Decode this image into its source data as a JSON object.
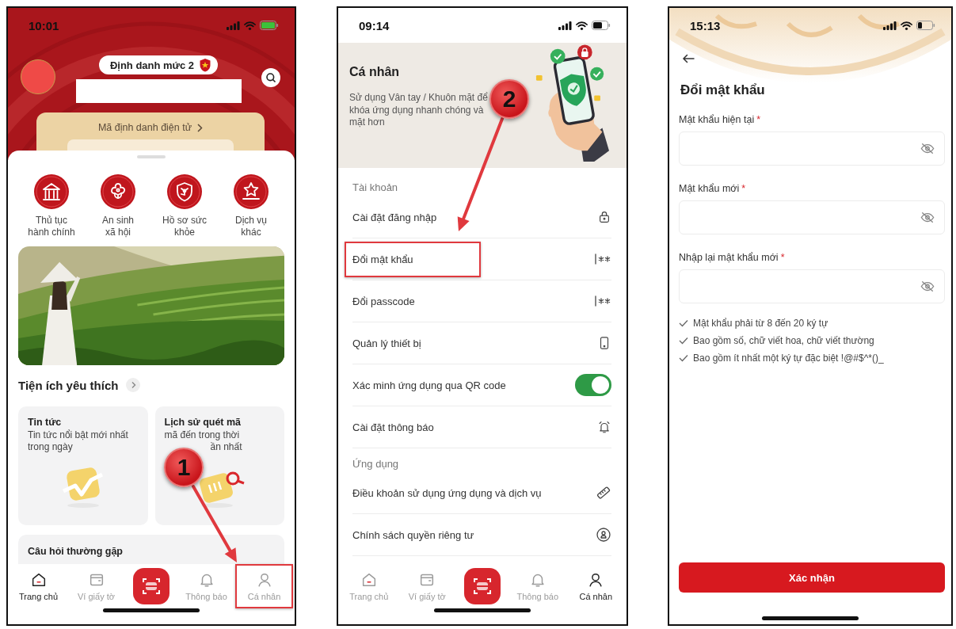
{
  "phones": [
    {
      "kind": "home",
      "status_time": "10:01",
      "level_badge": "Định danh mức 2",
      "id_link": "Mã định danh điện tử",
      "services": [
        {
          "label": "Thủ tục\nhành chính"
        },
        {
          "label": "An sinh\nxã hội"
        },
        {
          "label": "Hồ sơ sức\nkhỏe"
        },
        {
          "label": "Dịch vụ\nkhác"
        }
      ],
      "favorites_title": "Tiện ích yêu thích",
      "cards": [
        {
          "title": "Tin tức",
          "lines": [
            "Tin tức nổi bật mới nhất",
            "trong ngày"
          ]
        },
        {
          "title": "Lịch sử quét mã",
          "lines": [
            "mã đến trong thời",
            "ần nhất"
          ]
        }
      ],
      "faq_title": "Câu hỏi thường gặp",
      "tabs": [
        {
          "label": "Trang chủ",
          "selected": true,
          "highlighted": false
        },
        {
          "label": "Ví giấy tờ",
          "selected": false,
          "highlighted": false
        },
        {
          "label": "Thông báo",
          "selected": false,
          "highlighted": false
        },
        {
          "label": "Cá nhân",
          "selected": false,
          "highlighted": true
        }
      ],
      "annotation": {
        "step": "1"
      }
    },
    {
      "kind": "settings",
      "status_time": "09:14",
      "title": "Cá nhân",
      "intro": [
        "Sử dụng Vân tay / Khuôn mặt để",
        "khóa ứng dụng nhanh chóng và",
        "mặt hơn"
      ],
      "sections": [
        {
          "title": "Tài khoản",
          "items": [
            {
              "label": "Cài đặt đăng nhập",
              "kind": "lock",
              "highlighted": false
            },
            {
              "label": "Đổi mật khẩu",
              "kind": "password",
              "highlighted": true
            },
            {
              "label": "Đổi passcode",
              "kind": "password",
              "highlighted": false
            },
            {
              "label": "Quản lý thiết bị",
              "kind": "device",
              "highlighted": false
            },
            {
              "label": "Xác minh ứng dụng qua QR code",
              "kind": "toggle",
              "on": true,
              "highlighted": false
            },
            {
              "label": "Cài đặt thông báo",
              "kind": "bell",
              "highlighted": false
            }
          ]
        },
        {
          "title": "Ứng dụng",
          "items": [
            {
              "label": "Điều khoản sử dụng ứng dụng và dịch vụ",
              "kind": "ruler",
              "highlighted": false
            },
            {
              "label": "Chính sách quyền riêng tư",
              "kind": "privacy",
              "highlighted": false
            }
          ]
        }
      ],
      "tabs": [
        {
          "label": "Trang chủ",
          "selected": false,
          "highlighted": false
        },
        {
          "label": "Ví giấy tờ",
          "selected": false,
          "highlighted": false
        },
        {
          "label": "Thông báo",
          "selected": false,
          "highlighted": false
        },
        {
          "label": "Cá nhân",
          "selected": true,
          "highlighted": false
        }
      ],
      "annotation": {
        "step": "2"
      }
    },
    {
      "kind": "change_password",
      "status_time": "15:13",
      "title": "Đổi mật khẩu",
      "fields": [
        {
          "label": "Mật khẩu hiện tại",
          "required_mark": "*"
        },
        {
          "label": "Mật khẩu mới",
          "required_mark": "*"
        },
        {
          "label": "Nhập lại mật khẩu mới",
          "required_mark": "*"
        }
      ],
      "rules": [
        "Mật khẩu phải từ 8 đến 20 ký tự",
        "Bao gồm số, chữ viết hoa, chữ viết thường",
        "Bao gồm ít nhất một ký tự đặc biệt !@#$^*()_"
      ],
      "submit": "Xác nhận"
    }
  ]
}
